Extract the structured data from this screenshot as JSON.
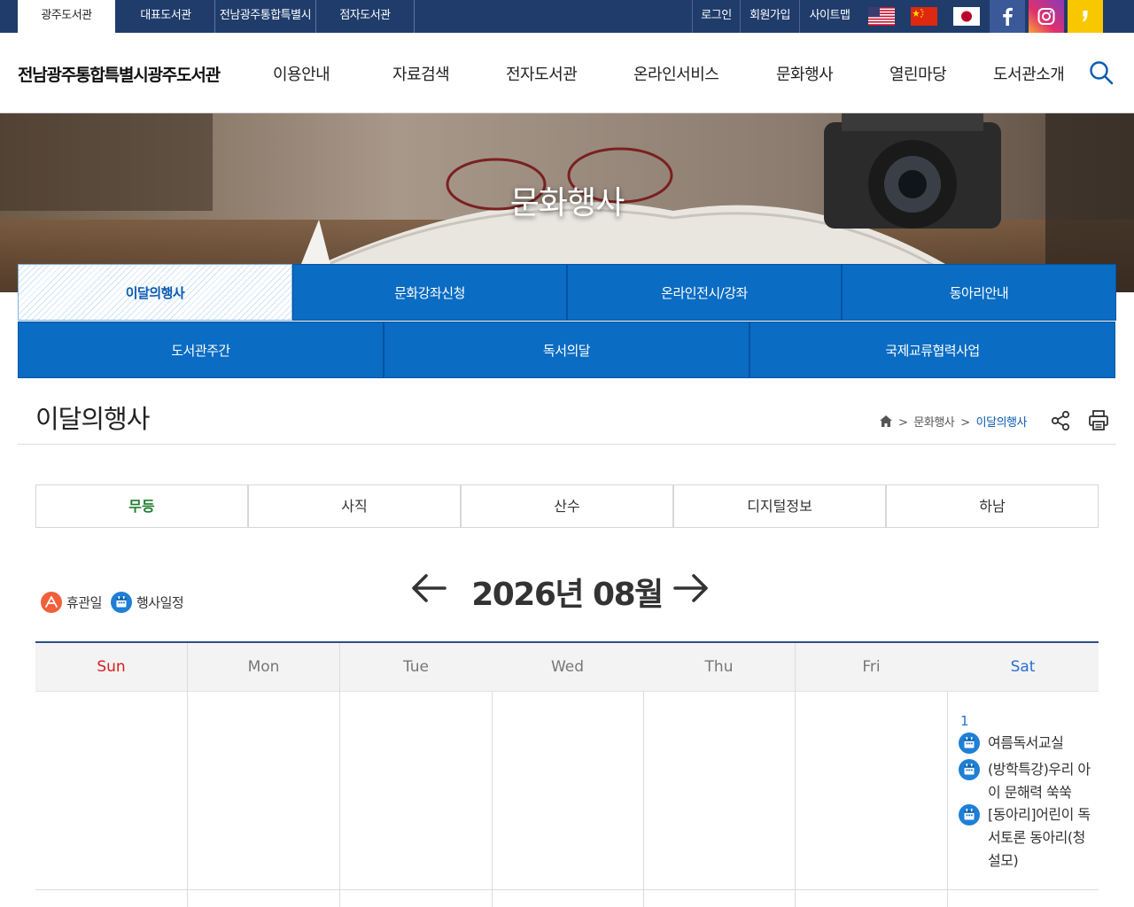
{
  "topbar": {
    "libraries": [
      "광주도서관",
      "대표도서관",
      "전남광주통합특별시",
      "점자도서관"
    ],
    "utils": [
      "로그인",
      "회원가입",
      "사이트맵"
    ],
    "flags": [
      "us-flag-icon",
      "china-flag-icon",
      "japan-flag-icon"
    ],
    "social": [
      "facebook-icon",
      "instagram-icon",
      "kakao-story-icon"
    ]
  },
  "header": {
    "logo": "전남광주통합특별시광주도서관",
    "nav": [
      "이용안내",
      "자료검색",
      "전자도서관",
      "온라인서비스",
      "문화행사",
      "열린마당",
      "도서관소개"
    ]
  },
  "banner": {
    "title": "문화행사"
  },
  "submenu": {
    "row1": [
      "이달의행사",
      "문화강좌신청",
      "온라인전시/강좌",
      "동아리안내"
    ],
    "row2": [
      "도서관주간",
      "독서의달",
      "국제교류협력사업"
    ]
  },
  "page": {
    "title": "이달의행사",
    "breadcrumb": [
      "문화행사",
      "이달의행사"
    ],
    "breadcrumb_sep": ">"
  },
  "branches": [
    "무등",
    "사직",
    "산수",
    "디지털정보",
    "하남"
  ],
  "calendar": {
    "legend": {
      "holiday": "휴관일",
      "event": "행사일정"
    },
    "month_title": "2026년 08월",
    "weekdays": [
      "Sun",
      "Mon",
      "Tue",
      "Wed",
      "Thu",
      "Fri",
      "Sat"
    ],
    "first_day": "1",
    "events": [
      "여름독서교실",
      "(방학특강)우리 아이 문해력 쑥쑥",
      "[동아리]어린이 독서토론 동아리(청설모)"
    ]
  },
  "colors": {
    "topbar": "#1f3c6b",
    "submenu": "#0a6cc2",
    "branch_active": "#1f7d2e",
    "sunday": "#d21f1f",
    "saturday": "#2a6fd0"
  }
}
